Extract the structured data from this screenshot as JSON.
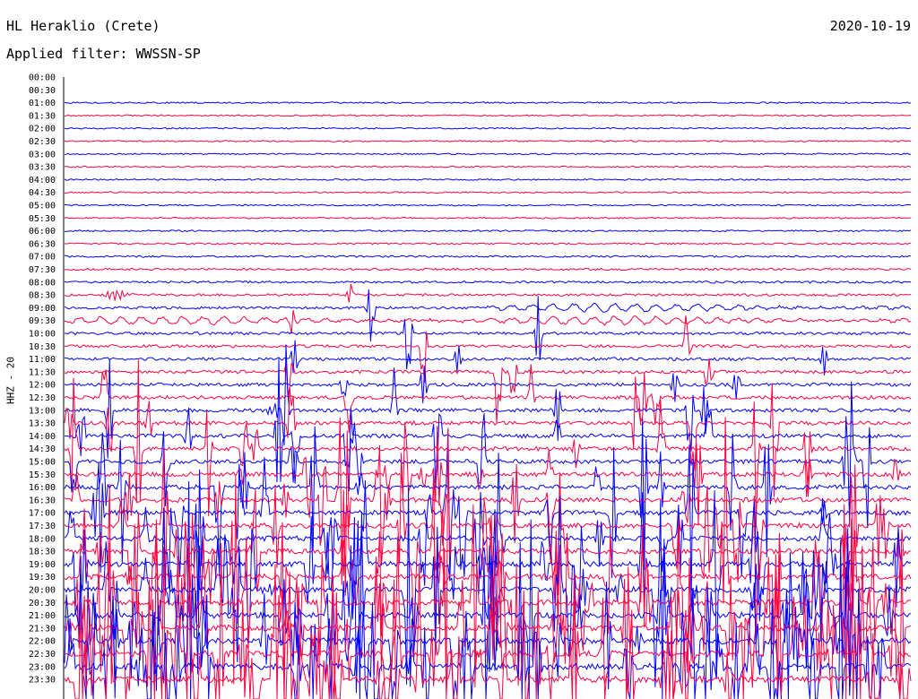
{
  "header": {
    "station": "HL Heraklio (Crete)",
    "date": "2020-10-19",
    "filter": "Applied filter: WWSSN-SP"
  },
  "channel_label": "HHZ - 20",
  "colors": {
    "blue": "#0000ff",
    "red": "#ff0040",
    "axis": "#000000"
  },
  "chart_data": {
    "type": "line",
    "title": "HL Heraklio (Crete)",
    "subtitle": "Applied filter: WWSSN-SP",
    "ylabel": "HHZ - 20",
    "xlabel": "",
    "row_labels": [
      "00:00",
      "00:30",
      "01:00",
      "01:30",
      "02:00",
      "02:30",
      "03:00",
      "03:30",
      "04:00",
      "04:30",
      "05:00",
      "05:30",
      "06:00",
      "06:30",
      "07:00",
      "07:30",
      "08:00",
      "08:30",
      "09:00",
      "09:30",
      "10:00",
      "10:30",
      "11:00",
      "11:30",
      "12:00",
      "12:30",
      "13:00",
      "13:30",
      "14:00",
      "14:30",
      "15:00",
      "15:30",
      "16:00",
      "16:30",
      "17:00",
      "17:30",
      "18:00",
      "18:30",
      "19:00",
      "19:30",
      "20:00",
      "20:30",
      "21:00",
      "21:30",
      "22:00",
      "22:30",
      "23:00",
      "23:30"
    ],
    "series_colors": [
      "blue",
      "red"
    ],
    "events": [
      {
        "row": "08:30",
        "at": 0.06,
        "kind": "burst"
      },
      {
        "row": "09:00",
        "at": 0.5,
        "kind": "long-period"
      },
      {
        "row": "09:30",
        "at": 0.0,
        "kind": "long-period"
      },
      {
        "row": "13:00",
        "at": 0.25,
        "kind": "burst"
      },
      {
        "row": "20:00",
        "at": 0.24,
        "kind": "burst"
      }
    ],
    "activity_onset_row": "05:30",
    "grid": false
  }
}
